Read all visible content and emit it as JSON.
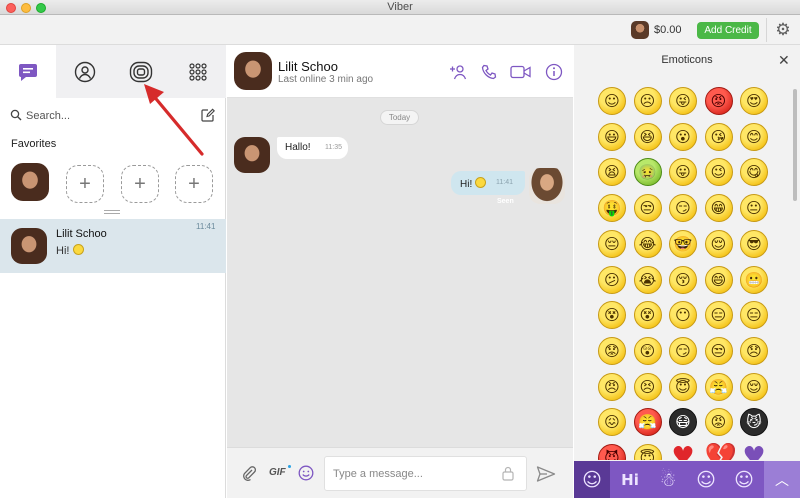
{
  "window": {
    "title": "Viber"
  },
  "topbar": {
    "balance": "$0.00",
    "add_credit_label": "Add Credit"
  },
  "left": {
    "search_placeholder": "Search...",
    "favorites_label": "Favorites",
    "fav_add_symbol": "+",
    "chats": [
      {
        "name": "Lilit Schoo",
        "message": "Hi!",
        "time": "11:41"
      }
    ]
  },
  "chat": {
    "contact_name": "Lilit Schoo",
    "status": "Last online 3 min ago",
    "day_label": "Today",
    "messages": [
      {
        "direction": "in",
        "text": "Hallo!",
        "time": "11:35"
      },
      {
        "direction": "out",
        "text": "Hi!",
        "time": "11:41",
        "status": "Seen"
      }
    ],
    "composer_placeholder": "Type a message...",
    "gif_label": "GIF"
  },
  "emoticons": {
    "title": "Emoticons",
    "close_symbol": "✕",
    "grid": [
      "☺",
      "☹",
      "😜",
      "😡",
      "😍",
      "😃",
      "😆",
      "😮",
      "😘",
      "😊",
      "😫",
      "🤢",
      "😛",
      "😉",
      "😋",
      "🤑",
      "😒",
      "😏",
      "😁",
      "😐",
      "😔",
      "😂",
      "🤓",
      "😌",
      "😎",
      "😕",
      "😭",
      "😚",
      "😄",
      "😬",
      "😵",
      "😵",
      "😶",
      "😑",
      "😑",
      "😟",
      "😲",
      "😏",
      "😒",
      "😞",
      "😠",
      "😣",
      "😇",
      "😤",
      "😌",
      "😖",
      "😤",
      "😷",
      "😡",
      "😼",
      "😈",
      "😇",
      "♥",
      "💔",
      "♥"
    ],
    "tabs": [
      "☺",
      "Hi",
      "☃",
      "☺",
      "☺"
    ],
    "collapse_symbol": "︿"
  }
}
